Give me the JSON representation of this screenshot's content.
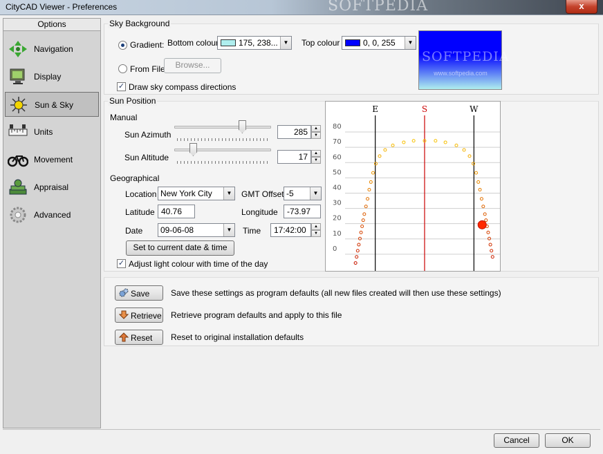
{
  "window": {
    "title": "CityCAD Viewer - Preferences",
    "close_glyph": "x",
    "watermark": "SOFTPEDIA"
  },
  "sidebar": {
    "header": "Options",
    "items": [
      {
        "label": "Navigation",
        "icon": "navigation-arrows-icon"
      },
      {
        "label": "Display",
        "icon": "monitor-icon"
      },
      {
        "label": "Sun & Sky",
        "icon": "sun-icon",
        "active": true
      },
      {
        "label": "Units",
        "icon": "ruler-icon"
      },
      {
        "label": "Movement",
        "icon": "bicycle-icon"
      },
      {
        "label": "Appraisal",
        "icon": "money-stack-icon"
      },
      {
        "label": "Advanced",
        "icon": "gear-icon"
      }
    ]
  },
  "sky": {
    "legend": "Sky Background",
    "gradient_label": "Gradient:",
    "bottom_label": "Bottom colour",
    "bottom_value": "175, 238...",
    "bottom_color": "#afeeee",
    "top_label": "Top colour",
    "top_value": "0, 0, 255",
    "top_color": "#0000ff",
    "from_file_label": "From File",
    "browse_label": "Browse...",
    "compass_label": "Draw sky compass directions",
    "preview_watermark": "SOFTPEDIA",
    "preview_url": "www.softpedia.com"
  },
  "sun": {
    "legend": "Sun Position",
    "manual_label": "Manual",
    "azimuth_label": "Sun Azimuth",
    "azimuth_value": "285",
    "altitude_label": "Sun Altitude",
    "altitude_value": "17",
    "geo_label": "Geographical",
    "location_label": "Location",
    "location_value": "New York City",
    "gmt_label": "GMT Offset",
    "gmt_value": "-5",
    "lat_label": "Latitude",
    "lat_value": "40.76",
    "lon_label": "Longitude",
    "lon_value": "-73.97",
    "date_label": "Date",
    "date_value": "09-06-08",
    "time_label": "Time",
    "time_value": "17:42:00",
    "set_current_label": "Set to current date & time",
    "adjust_label": "Adjust light colour with time of the day",
    "azimuth_fraction": 0.72,
    "altitude_fraction": 0.17
  },
  "chart_data": {
    "type": "scatter",
    "directions": [
      "E",
      "S",
      "W"
    ],
    "y_ticks": [
      "80",
      "70",
      "60",
      "50",
      "40",
      "30",
      "20",
      "10",
      "0"
    ],
    "ylim": [
      -10,
      85
    ],
    "xlim": [
      45,
      315
    ],
    "direction_azimuths": [
      90,
      180,
      270
    ],
    "direction_colors": [
      "#000000",
      "#cc0000",
      "#000000"
    ],
    "grid": true,
    "path_points": [
      [
        54,
        -8
      ],
      [
        56,
        -4
      ],
      [
        58,
        0
      ],
      [
        60,
        4
      ],
      [
        62,
        8
      ],
      [
        64,
        12
      ],
      [
        66,
        16
      ],
      [
        68,
        20
      ],
      [
        70,
        24
      ],
      [
        73,
        29
      ],
      [
        76,
        34
      ],
      [
        79,
        40
      ],
      [
        82,
        45
      ],
      [
        86,
        51
      ],
      [
        91,
        57
      ],
      [
        98,
        62
      ],
      [
        108,
        66
      ],
      [
        122,
        69
      ],
      [
        142,
        71
      ],
      [
        160,
        72
      ],
      [
        180,
        72
      ],
      [
        200,
        72
      ],
      [
        218,
        71
      ],
      [
        238,
        69
      ],
      [
        252,
        66
      ],
      [
        262,
        62
      ],
      [
        269,
        57
      ],
      [
        274,
        51
      ],
      [
        278,
        45
      ],
      [
        281,
        40
      ],
      [
        284,
        34
      ],
      [
        287,
        29
      ],
      [
        290,
        24
      ],
      [
        292,
        20
      ],
      [
        294,
        16
      ],
      [
        296,
        12
      ],
      [
        298,
        8
      ],
      [
        300,
        4
      ],
      [
        302,
        0
      ],
      [
        304,
        -4
      ]
    ],
    "current_sun": [
      285,
      17
    ]
  },
  "defaults": {
    "save_label": "Save",
    "save_desc": "Save these settings as program defaults (all new files created will then use these settings)",
    "retrieve_label": "Retrieve",
    "retrieve_desc": "Retrieve program defaults and apply to this file",
    "reset_label": "Reset",
    "reset_desc": "Reset to original installation defaults"
  },
  "footer": {
    "cancel_label": "Cancel",
    "ok_label": "OK"
  }
}
